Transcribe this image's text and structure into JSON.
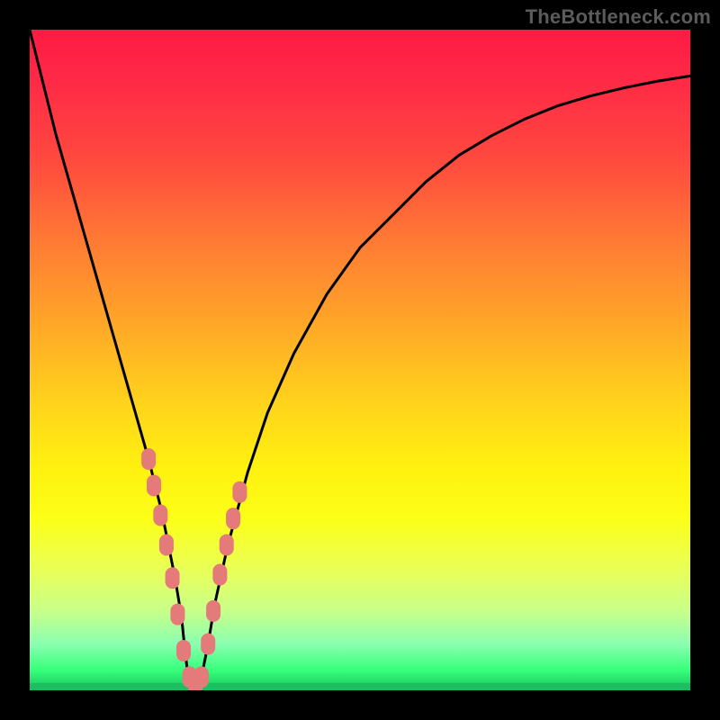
{
  "watermark": "TheBottleneck.com",
  "colors": {
    "frame": "#000000",
    "curve": "#000000",
    "points": "#e47a79",
    "gradient_top": "#ff1a44",
    "gradient_bottom": "#18c060"
  },
  "chart_data": {
    "type": "line",
    "title": "",
    "xlabel": "",
    "ylabel": "",
    "xlim": [
      0,
      100
    ],
    "ylim": [
      0,
      100
    ],
    "annotations": [
      "TheBottleneck.com"
    ],
    "series": [
      {
        "name": "bottleneck-curve",
        "x": [
          0,
          2,
          4,
          6,
          8,
          10,
          12,
          14,
          16,
          18,
          20,
          21,
          22,
          23,
          23.5,
          24,
          25,
          26,
          27,
          28,
          30,
          33,
          36,
          40,
          45,
          50,
          55,
          60,
          65,
          70,
          75,
          80,
          85,
          90,
          95,
          100
        ],
        "y": [
          100,
          92,
          84,
          77,
          70,
          63,
          56,
          49,
          42,
          35,
          27,
          22,
          17,
          11,
          6,
          2,
          0,
          2,
          7,
          13,
          22,
          33,
          42,
          51,
          60,
          67,
          72,
          77,
          81,
          84,
          86.5,
          88.5,
          90,
          91.2,
          92.2,
          93
        ]
      }
    ],
    "scatter_points": {
      "name": "highlighted-samples",
      "x": [
        18.0,
        18.8,
        19.8,
        20.7,
        21.6,
        22.4,
        23.3,
        24.2,
        25.1,
        26.0,
        27.0,
        27.8,
        28.8,
        29.8,
        30.8,
        31.8
      ],
      "y": [
        35.0,
        31.0,
        26.5,
        22.0,
        17.0,
        11.5,
        6.0,
        2.0,
        0.5,
        2.0,
        7.0,
        12.0,
        17.5,
        22.0,
        26.0,
        30.0
      ]
    }
  }
}
